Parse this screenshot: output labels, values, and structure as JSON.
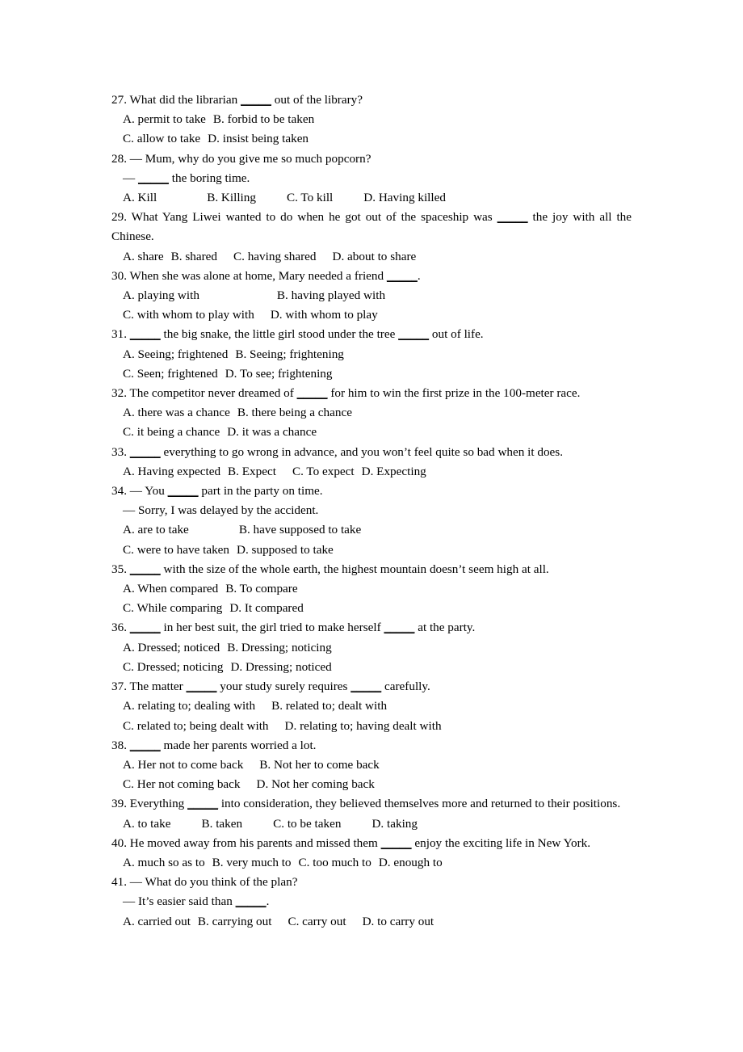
{
  "document": {
    "type": "grammar-multiple-choice-worksheet",
    "blank_glyph": "_____",
    "dash_glyph": "—"
  },
  "questions": [
    {
      "number": "27.",
      "stem_before": " What did the librarian ",
      "stem_after": " out of the library?",
      "option_rows": [
        {
          "a": "A. permit to take",
          "b": "B. forbid to be taken"
        },
        {
          "a": "C. allow to take",
          "b": "D. insist being taken"
        }
      ]
    },
    {
      "number": "28.",
      "stem_line": " — Mum, why do you give me so much popcorn?",
      "reply_before": "— ",
      "reply_after": " the boring time.",
      "option_row": {
        "a": "A. Kill",
        "b": "B. Killing",
        "c": "C. To kill",
        "d": "D. Having killed"
      }
    },
    {
      "number": "29.",
      "stem_before": " What Yang Liwei wanted to do when he got out of the spaceship was ",
      "stem_after": " the joy with all the Chinese.",
      "option_row": {
        "a": "A. share",
        "b": "B. shared",
        "c": "C. having shared",
        "d": "D. about to share"
      }
    },
    {
      "number": "30.",
      "stem_before": " When she was alone at home, Mary needed a friend ",
      "stem_after": ".",
      "option_rows": [
        {
          "a": "A. playing with",
          "b": "B. having played with"
        },
        {
          "a": "C. with whom to play with",
          "b": "D. with whom to play"
        }
      ]
    },
    {
      "number": "31.",
      "stem_mid": " the big snake, the little girl stood under the tree ",
      "stem_after": " out of life.",
      "option_rows": [
        {
          "a": "A. Seeing; frightened",
          "b": "B. Seeing; frightening"
        },
        {
          "a": "C. Seen; frightened",
          "b": "D. To see; frightening"
        }
      ]
    },
    {
      "number": "32.",
      "stem_before": " The competitor never dreamed of ",
      "stem_after": " for him to win the first prize in the 100-meter race.",
      "option_rows": [
        {
          "a": "A. there was a chance",
          "b": "B. there being a chance"
        },
        {
          "a": "C. it being a chance",
          "b": "D. it was a chance"
        }
      ]
    },
    {
      "number": "33.",
      "stem_mid": " everything to go wrong in advance, and you won’t feel quite so bad when it does.",
      "option_row": {
        "a": "A. Having expected",
        "b": "B. Expect",
        "c": "C. To expect",
        "d": "D. Expecting"
      }
    },
    {
      "number": "34.",
      "stem_before": " — You ",
      "stem_after": " part in the party on time.",
      "reply_line": "— Sorry, I was delayed by the accident.",
      "option_rows": [
        {
          "a": "A. are to take",
          "b": "B. have supposed to take"
        },
        {
          "a": "C. were to have taken",
          "b": "D. supposed to take"
        }
      ]
    },
    {
      "number": "35.",
      "stem_mid": " with the size of the whole earth, the highest mountain doesn’t seem high at all.",
      "option_rows": [
        {
          "a": "A. When compared",
          "b": "B. To compare"
        },
        {
          "a": "C. While comparing",
          "b": "D. It compared"
        }
      ]
    },
    {
      "number": "36.",
      "stem_mid": " in her best suit, the girl tried to make herself ",
      "stem_after": " at the party.",
      "option_rows": [
        {
          "a": "A. Dressed; noticed",
          "b": "B. Dressing; noticing"
        },
        {
          "a": "C. Dressed; noticing",
          "b": "D. Dressing; noticed"
        }
      ]
    },
    {
      "number": "37.",
      "stem_before": " The matter ",
      "stem_mid": " your study surely requires ",
      "stem_after": " carefully.",
      "option_rows": [
        {
          "a": "A. relating to; dealing with",
          "b": "B. related to; dealt with"
        },
        {
          "a": "C. related to; being dealt with",
          "b": "D. relating to; having dealt with"
        }
      ]
    },
    {
      "number": "38.",
      "stem_mid": " made her parents worried a lot.",
      "option_rows": [
        {
          "a": "A. Her not to come back",
          "b": "B. Not her to come back"
        },
        {
          "a": "C. Her not coming back",
          "b": "D. Not her coming back"
        }
      ]
    },
    {
      "number": "39.",
      "stem_before": " Everything ",
      "stem_after": " into consideration, they believed themselves more and returned to their positions.",
      "option_row": {
        "a": "A. to take",
        "b": "B. taken",
        "c": "C. to be taken",
        "d": "D. taking"
      }
    },
    {
      "number": "40.",
      "stem_before": " He moved away from his parents and missed them ",
      "stem_after": " enjoy the exciting life in New York.",
      "option_row": {
        "a": "A. much so as to",
        "b": "B. very much to",
        "c": "C. too much to",
        "d": "D. enough to"
      }
    },
    {
      "number": "41.",
      "stem_line": " — What do you think of the plan?",
      "reply_before": "— It’s easier said than ",
      "reply_after": ".",
      "option_row": {
        "a": "A. carried out",
        "b": "B. carrying out",
        "c": "C. carry out",
        "d": "D. to carry out"
      }
    }
  ]
}
